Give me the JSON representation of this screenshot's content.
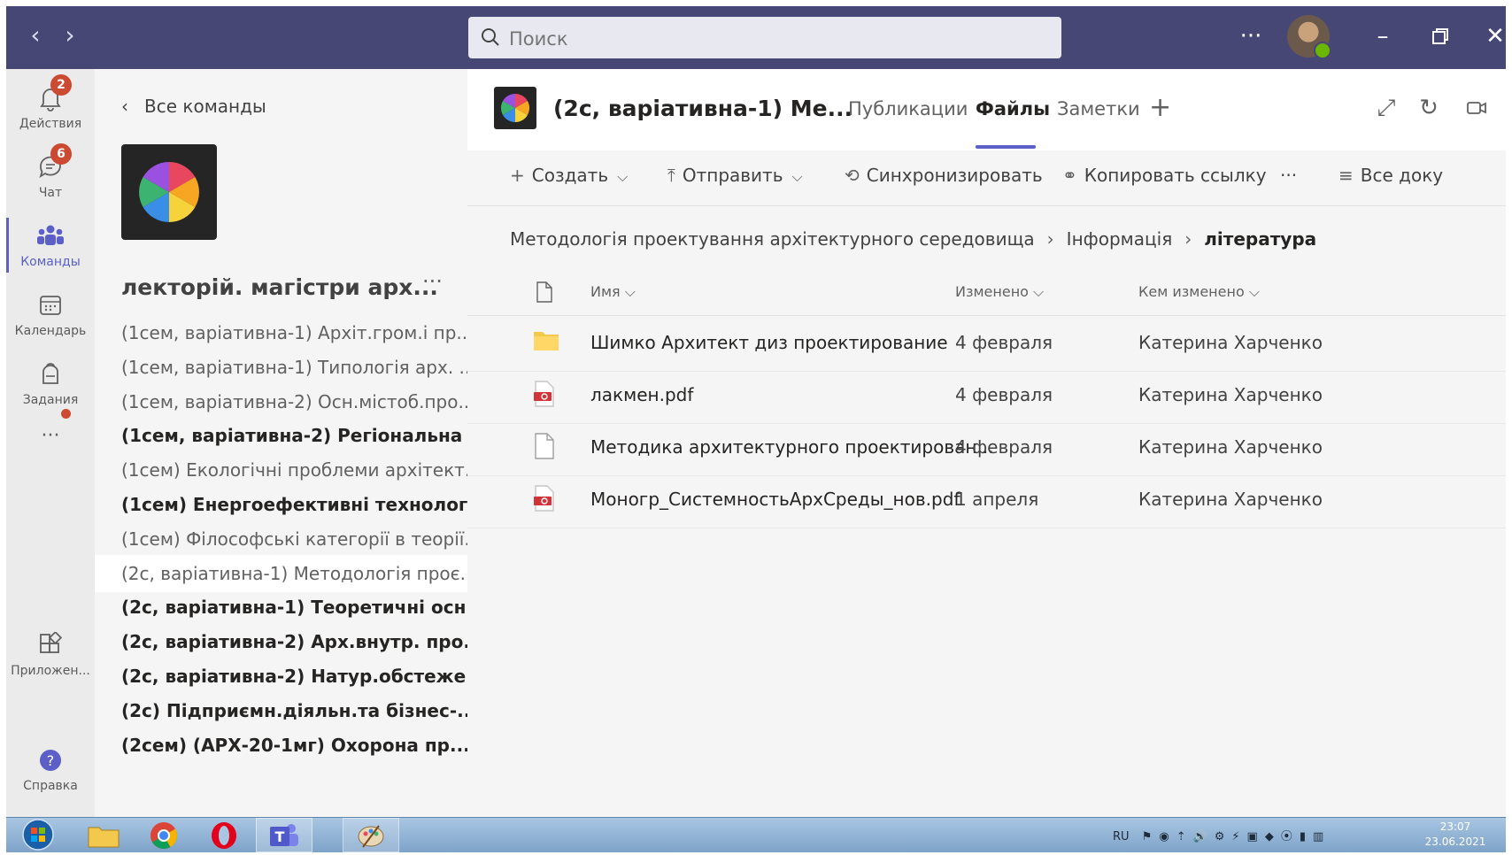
{
  "titlebar": {
    "search_placeholder": "Поиск",
    "more": "···"
  },
  "rail": {
    "items": [
      {
        "label": "Действия",
        "badge": "2"
      },
      {
        "label": "Чат",
        "badge": "6"
      },
      {
        "label": "Команды"
      },
      {
        "label": "Календарь"
      },
      {
        "label": "Задания"
      },
      {
        "label": "···"
      },
      {
        "label": "Приложен..."
      },
      {
        "label": "Справка"
      }
    ]
  },
  "teampanel": {
    "back_label": "Все команды",
    "team_name": "лекторій. магістри арх...",
    "more": "···",
    "channels": [
      {
        "label": "(1сем, варіативна-1) Архіт.гром.і пр...",
        "bold": false
      },
      {
        "label": "(1сем, варіативна-1) Типологія арх. ...",
        "bold": false
      },
      {
        "label": "(1сем, варіативна-2) Осн.містоб.про...",
        "bold": false
      },
      {
        "label": "(1сем, варіативна-2) Регіональна ...",
        "bold": true
      },
      {
        "label": "(1сем) Екологічні проблеми архітект...",
        "bold": false
      },
      {
        "label": "(1сем) Енергоефективні технолог...",
        "bold": true
      },
      {
        "label": "(1сем) Філософські категорії в теорії...",
        "bold": false
      },
      {
        "label": "(2с, варіативна-1) Методологія проє...",
        "bold": false,
        "selected": true
      },
      {
        "label": "(2с, варіативна-1) Теоретичні осн...",
        "bold": true
      },
      {
        "label": "(2с, варіативна-2) Арх.внутр. про...",
        "bold": true
      },
      {
        "label": "(2с, варіативна-2) Натур.обстеже...",
        "bold": true
      },
      {
        "label": "(2с) Підприємн.діяльн.та бізнес-...",
        "bold": true
      },
      {
        "label": "(2сем) (АРХ-20-1мг) Охорона пр...",
        "bold": true
      }
    ]
  },
  "channel": {
    "title": "(2с, варіативна-1) Ме...",
    "tabs": [
      "Публикации",
      "Файлы",
      "Заметки"
    ],
    "add_tab": "+"
  },
  "toolbar": {
    "create": "Создать",
    "upload": "Отправить",
    "sync": "Синхронизировать",
    "copy_link": "Копировать ссылку",
    "more": "···",
    "all_docs": "Все доку"
  },
  "breadcrumb": [
    "Методологія проектування архітектурного середовища",
    "Інформація",
    "література"
  ],
  "files": {
    "columns": {
      "name": "Имя",
      "modified": "Изменено",
      "modified_by": "Кем изменено"
    },
    "rows": [
      {
        "type": "folder",
        "name": "Шимко Архитект диз проектирование",
        "modified": "4 февраля",
        "by": "Катерина Харченко"
      },
      {
        "type": "pdf",
        "name": "лакмен.pdf",
        "modified": "4 февраля",
        "by": "Катерина Харченко"
      },
      {
        "type": "file",
        "name": "Методика архитектурного проектирован...",
        "modified": "4 февраля",
        "by": "Катерина Харченко"
      },
      {
        "type": "pdf",
        "name": "Моногр_СистемностьАрхСреды_нов.pdf",
        "modified": "1 апреля",
        "by": "Катерина Харченко"
      }
    ]
  },
  "taskbar": {
    "lang": "RU",
    "time": "23:07",
    "date": "23.06.2021"
  },
  "colors": {
    "titlebar": "#464775",
    "accent": "#5b5fc7",
    "badge": "#cc4a31"
  }
}
